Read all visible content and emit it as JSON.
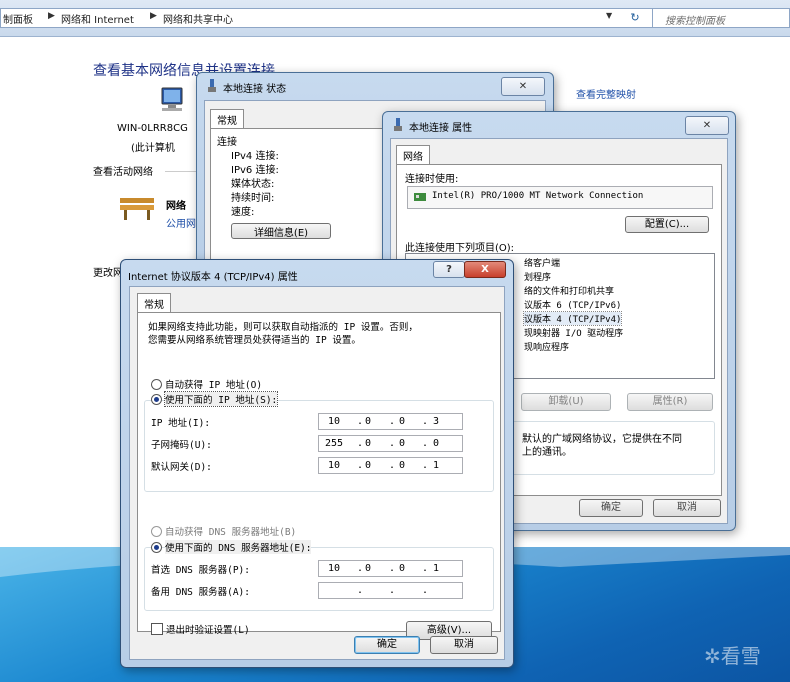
{
  "address_bar": {
    "crumbs": [
      "制面板",
      "网络和 Internet",
      "网络和共享中心"
    ],
    "search_placeholder": "搜索控制面板"
  },
  "control_panel": {
    "title": "查看基本网络信息并设置连接",
    "full_map_link": "查看完整映射",
    "computer_name": "WIN-0LRR8CG",
    "computer_sub": "(此计算机",
    "active_networks_label": "查看活动网络",
    "network_name": "网络",
    "network_type": "公用网",
    "change_settings_prefix": "更改网"
  },
  "status_window": {
    "title": "本地连接 状态",
    "tab": "常规",
    "section_connection": "连接",
    "rows": [
      "IPv4 连接:",
      "IPv6 连接:",
      "媒体状态:",
      "持续时间:",
      "速度:"
    ],
    "details_button": "详细信息(E)"
  },
  "properties_window": {
    "title": "本地连接 属性",
    "tab": "网络",
    "connect_using_label": "连接时使用:",
    "adapter": "Intel(R) PRO/1000 MT Network Connection",
    "configure_button": "配置(C)...",
    "items_label": "此连接使用下列项目(O):",
    "items": [
      "络客户端",
      "划程序",
      "络的文件和打印机共享",
      "议版本 6 (TCP/IPv6)",
      "议版本 4 (TCP/IPv4)",
      "现映射器 I/O 驱动程序",
      "现响应程序"
    ],
    "uninstall_button": "卸载(U)",
    "properties_button": "属性(R)",
    "description": [
      "默认的广域网络协议，它提供在不同",
      "上的通讯。"
    ],
    "ok_button": "确定",
    "cancel_button": "取消"
  },
  "ipv4_dialog": {
    "title": "Internet 协议版本 4 (TCP/IPv4) 属性",
    "help_button": "?",
    "close_button": "X",
    "tab": "常规",
    "intro": [
      "如果网络支持此功能，则可以获取自动指派的 IP 设置。否则，",
      "您需要从网络系统管理员处获得适当的 IP 设置。"
    ],
    "auto_ip_label": "自动获得 IP 地址(O)",
    "manual_ip_label": "使用下面的 IP 地址(S):",
    "ip_label": "IP 地址(I):",
    "ip_value": [
      "10",
      "0",
      "0",
      "3"
    ],
    "subnet_label": "子网掩码(U):",
    "subnet_value": [
      "255",
      "0",
      "0",
      "0"
    ],
    "gateway_label": "默认网关(D):",
    "gateway_value": [
      "10",
      "0",
      "0",
      "1"
    ],
    "auto_dns_label": "自动获得 DNS 服务器地址(B)",
    "manual_dns_label": "使用下面的 DNS 服务器地址(E):",
    "preferred_dns_label": "首选 DNS 服务器(P):",
    "preferred_dns_value": [
      "10",
      "0",
      "0",
      "1"
    ],
    "alternate_dns_label": "备用 DNS 服务器(A):",
    "validate_label": "退出时验证设置(L)",
    "advanced_button": "高级(V)...",
    "ok_button": "确定",
    "cancel_button": "取消"
  },
  "watermark": "看雪",
  "colors": {
    "link": "#1e4fa8",
    "title_blue": "#1e3287",
    "close_red": "#c8402c",
    "desktop": "#1a86cf"
  }
}
